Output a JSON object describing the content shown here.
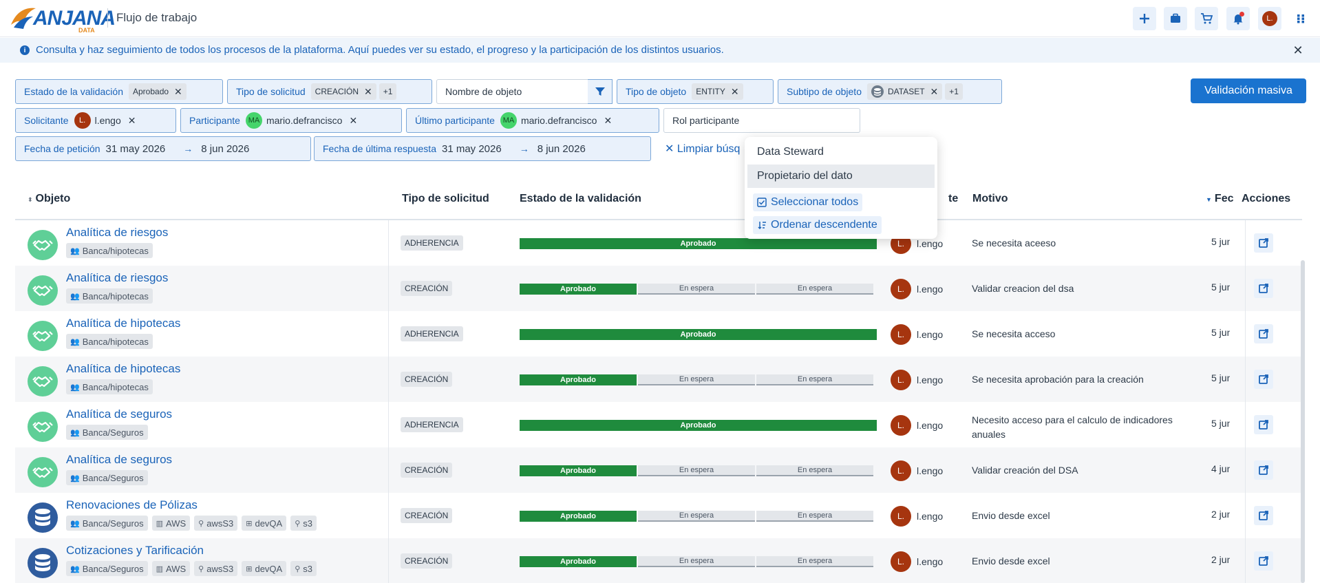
{
  "header": {
    "logo_text": "ANJANA",
    "logo_sub": "DATA",
    "title": "Flujo de trabajo",
    "user_initials": "L.",
    "icons": [
      "plus-icon",
      "briefcase-icon",
      "cart-icon",
      "bell-icon",
      "apps-grid-icon"
    ]
  },
  "banner": {
    "text": "Consulta y haz seguimiento de todos los procesos de la plataforma. Aquí puedes ver su estado, el progreso y la participación de los distintos usuarios.",
    "close": "✕"
  },
  "filters": {
    "estado_label": "Estado de la validación",
    "estado_value": "Aprobado",
    "tipo_solicitud_label": "Tipo de solicitud",
    "tipo_solicitud_value": "CREACIÓN",
    "tipo_solicitud_more": "+1",
    "nombre_objeto_placeholder": "Nombre de objeto",
    "tipo_objeto_label": "Tipo de objeto",
    "tipo_objeto_value": "ENTITY",
    "subtipo_label": "Subtipo de objeto",
    "subtipo_value": "DATASET",
    "subtipo_more": "+1",
    "solicitante_label": "Solicitante",
    "solicitante_initials": "L.",
    "solicitante_value": "l.engo",
    "participante_label": "Participante",
    "participante_initials": "MA",
    "participante_value": "mario.defrancisco",
    "ultimo_label": "Último participante",
    "ultimo_initials": "MA",
    "ultimo_value": "mario.defrancisco",
    "rol_placeholder": "Rol participante",
    "fecha_peticion_label": "Fecha de petición",
    "fecha_peticion_from": "31 may 2026",
    "fecha_peticion_to": "8 jun 2026",
    "fecha_respuesta_label": "Fecha de última respuesta",
    "fecha_respuesta_from": "31 may 2026",
    "fecha_respuesta_to": "8 jun 2026",
    "clear": "✕ Limpiar búsq",
    "bulk_button": "Validación masiva"
  },
  "dropdown": {
    "items": [
      "Data Steward",
      "Propietario del dato"
    ],
    "select_all": "Seleccionar todos",
    "sort_desc": "Ordenar descendente"
  },
  "table": {
    "headers": {
      "objeto": "Objeto",
      "tipo": "Tipo de solicitud",
      "estado": "Estado de la validación",
      "solicitante": "te",
      "motivo": "Motivo",
      "fecha": "Fec",
      "acciones": "Acciones"
    },
    "rows": [
      {
        "title": "Analítica de riesgos",
        "icon": "handshake",
        "tags": [
          "Banca/hipotecas"
        ],
        "tipo": "ADHERENCIA",
        "bars": [
          "Aprobado"
        ],
        "req_initials": "L.",
        "req": "l.engo",
        "motivo": "Se necesita aceeso",
        "fecha": "5 jun"
      },
      {
        "title": "Analítica de riesgos",
        "icon": "handshake",
        "tags": [
          "Banca/hipotecas"
        ],
        "tipo": "CREACIÓN",
        "bars": [
          "Aprobado",
          "En espera",
          "En espera"
        ],
        "req_initials": "L.",
        "req": "l.engo",
        "motivo": "Validar creacion del dsa",
        "fecha": "5 jun"
      },
      {
        "title": "Analítica de hipotecas",
        "icon": "handshake",
        "tags": [
          "Banca/hipotecas"
        ],
        "tipo": "ADHERENCIA",
        "bars": [
          "Aprobado"
        ],
        "req_initials": "L.",
        "req": "l.engo",
        "motivo": "Se necesita acceso",
        "fecha": "5 jun"
      },
      {
        "title": "Analítica de hipotecas",
        "icon": "handshake",
        "tags": [
          "Banca/hipotecas"
        ],
        "tipo": "CREACIÓN",
        "bars": [
          "Aprobado",
          "En espera",
          "En espera"
        ],
        "req_initials": "L.",
        "req": "l.engo",
        "motivo": "Se necesita aprobación para la creación",
        "fecha": "5 jun"
      },
      {
        "title": "Analítica de seguros",
        "icon": "handshake",
        "tags": [
          "Banca/Seguros"
        ],
        "tipo": "ADHERENCIA",
        "bars": [
          "Aprobado"
        ],
        "req_initials": "L.",
        "req": "l.engo",
        "motivo": "Necesito acceso para el calculo de indicadores anuales",
        "fecha": "5 jun"
      },
      {
        "title": "Analítica de seguros",
        "icon": "handshake",
        "tags": [
          "Banca/Seguros"
        ],
        "tipo": "CREACIÓN",
        "bars": [
          "Aprobado",
          "En espera",
          "En espera"
        ],
        "req_initials": "L.",
        "req": "l.engo",
        "motivo": "Validar creación del DSA",
        "fecha": "4 jun"
      },
      {
        "title": "Renovaciones de Pólizas",
        "icon": "database",
        "tags": [
          "Banca/Seguros",
          "AWS",
          "awsS3",
          "devQA",
          "s3"
        ],
        "tipo": "CREACIÓN",
        "bars": [
          "Aprobado",
          "En espera",
          "En espera"
        ],
        "req_initials": "L.",
        "req": "l.engo",
        "motivo": "Envio desde excel",
        "fecha": "2 jun"
      },
      {
        "title": "Cotizaciones y Tarificación",
        "icon": "database",
        "tags": [
          "Banca/Seguros",
          "AWS",
          "awsS3",
          "devQA",
          "s3"
        ],
        "tipo": "CREACIÓN",
        "bars": [
          "Aprobado",
          "En espera",
          "En espera"
        ],
        "req_initials": "L.",
        "req": "l.engo",
        "motivo": "Envio desde excel",
        "fecha": "2 jun"
      }
    ]
  },
  "colors": {
    "primary": "#1a73cf",
    "approved": "#1f8b3d",
    "pending": "#e3e6ea",
    "object_green": "#5fcf97",
    "object_blue": "#2f5c9e",
    "avatar_brown": "#a6350f"
  }
}
